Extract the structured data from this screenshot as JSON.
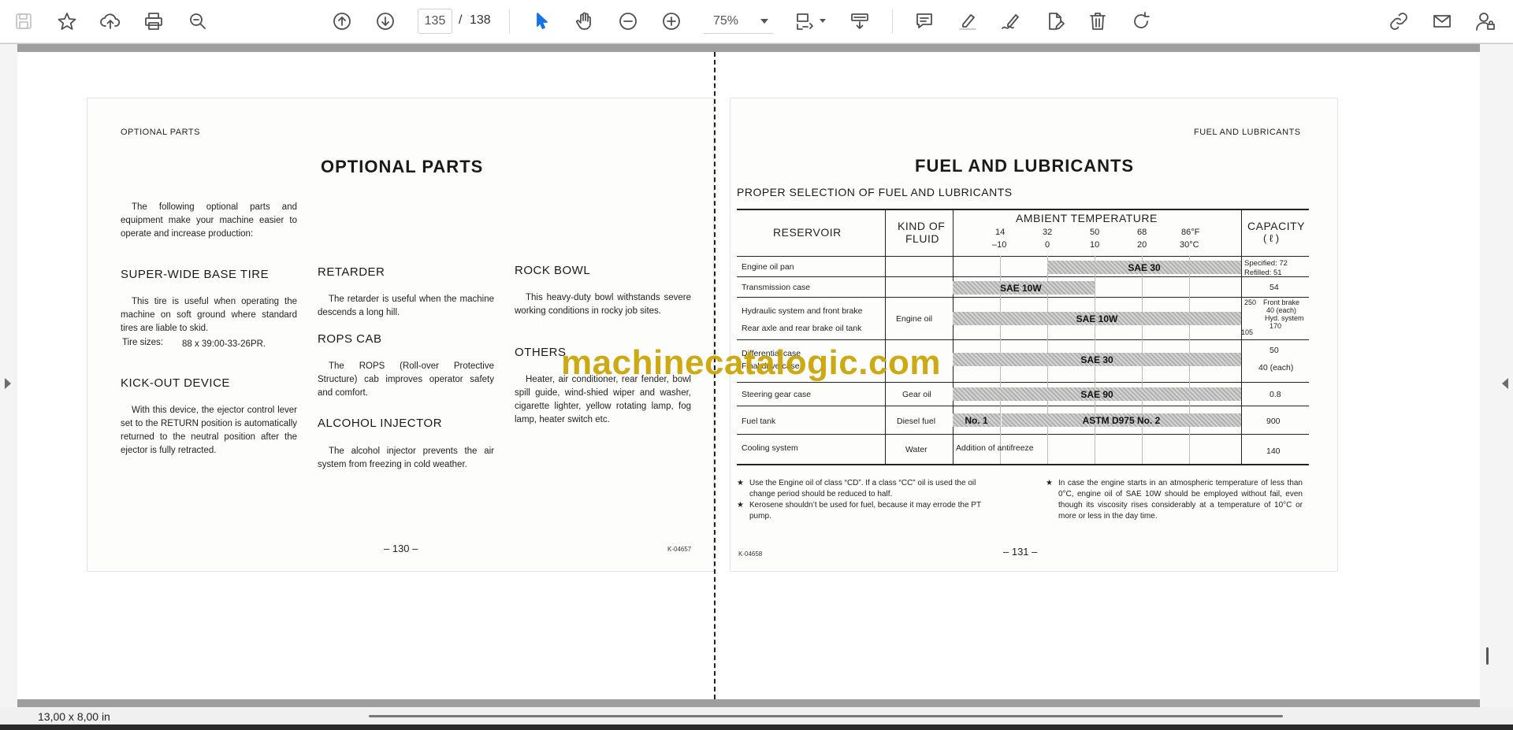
{
  "toolbar": {
    "page_current": "135",
    "page_separator": "/",
    "page_total": "138",
    "zoom": "75%"
  },
  "status": {
    "page_size": "13,00 x 8,00 in"
  },
  "watermark": "machinecatalogic.com",
  "left_page": {
    "header": "OPTIONAL PARTS",
    "title": "OPTIONAL PARTS",
    "intro": "The following optional parts and equipment make your machine easier to operate and increase production:",
    "super_wide": {
      "heading": "SUPER-WIDE BASE TIRE",
      "text": "This tire is useful when operating the machine on soft ground where standard tires are liable to skid.",
      "tire_label": "Tire sizes:",
      "tire_value": "88 x 39:00-33-26PR."
    },
    "kickout": {
      "heading": "KICK-OUT DEVICE",
      "text": "With this device, the ejector control lever set to the RETURN position is automatically returned to the neutral position after the ejector is fully retracted."
    },
    "retarder": {
      "heading": "RETARDER",
      "text": "The retarder is useful when the machine descends a long hill."
    },
    "rops": {
      "heading": "ROPS CAB",
      "text": "The ROPS (Roll-over Protective Structure) cab improves operator safety and comfort."
    },
    "alcohol": {
      "heading": "ALCOHOL INJECTOR",
      "text": "The alcohol injector prevents the air system from freezing in cold weather."
    },
    "rockbowl": {
      "heading": "ROCK BOWL",
      "text": "This heavy-duty bowl withstands severe working conditions in rocky job sites."
    },
    "others": {
      "heading": "OTHERS",
      "text": "Heater, air conditioner, rear fender, bowl spill guide, wind-shied wiper and washer, cigarette lighter, yellow rotating lamp, fog lamp, heater switch etc."
    },
    "page_number": "– 130 –",
    "code": "K-04657"
  },
  "right_page": {
    "header": "FUEL AND LUBRICANTS",
    "title": "FUEL AND LUBRICANTS",
    "subtitle": "PROPER SELECTION OF FUEL AND LUBRICANTS",
    "table": {
      "col_reservoir": "RESERVOIR",
      "col_fluid_1": "KIND OF",
      "col_fluid_2": "FLUID",
      "col_temp": "AMBIENT TEMPERATURE",
      "col_capacity_1": "CAPACITY",
      "col_capacity_2": "( ℓ )",
      "temps_f": [
        "14",
        "32",
        "50",
        "68",
        "86°F"
      ],
      "temps_c": [
        "–10",
        "0",
        "10",
        "20",
        "30°C"
      ],
      "rows": {
        "r1": "Engine oil pan",
        "r2": "Transmission case",
        "r3": "Hydraulic system and front brake",
        "r4": "Rear axle and rear brake oil tank",
        "r5": "Differential case",
        "r6": "Final drive case",
        "r7": "Steering gear case",
        "r8": "Fuel tank",
        "r9": "Cooling system"
      },
      "fluids": {
        "engine_oil": "Engine oil",
        "gear_oil": "Gear oil",
        "diesel": "Diesel fuel",
        "water": "Water"
      },
      "bars": {
        "sae30_top": "SAE 30",
        "sae10w_top": "SAE 10W",
        "sae10w_mid": "SAE 10W",
        "sae30_mid": "SAE 30",
        "sae90": "SAE 90",
        "no1": "No. 1",
        "astm": "ASTM D975 No. 2"
      },
      "antifreeze": "Addition of antifreeze",
      "capacity": {
        "c1a": "Specified: 72",
        "c1b": "Refilled:  51",
        "c2": "54",
        "c3a": "250",
        "c3b": "Front brake",
        "c3c": "40 (each)",
        "c3d": "Hyd. system",
        "c3e": "170",
        "c3f": "105",
        "c4": "50",
        "c5": "40 (each)",
        "c6": "0.8",
        "c7": "900",
        "c8": "140"
      }
    },
    "notes": {
      "star": "★",
      "n1": "Use the Engine oil of class “CD”. If a class “CC” oil is used the oil change period should be reduced to half.",
      "n2": "Kerosene shouldn’t be used for fuel, because it may errode the PT pump.",
      "n3": "In case the engine starts in an atmospheric temperature of less than 0°C, engine oil of SAE 10W should be employed without fail, even though its viscosity rises considerably at a temperature of 10°C or more or less in the day time."
    },
    "page_number": "– 131 –",
    "code": "K-04658"
  }
}
